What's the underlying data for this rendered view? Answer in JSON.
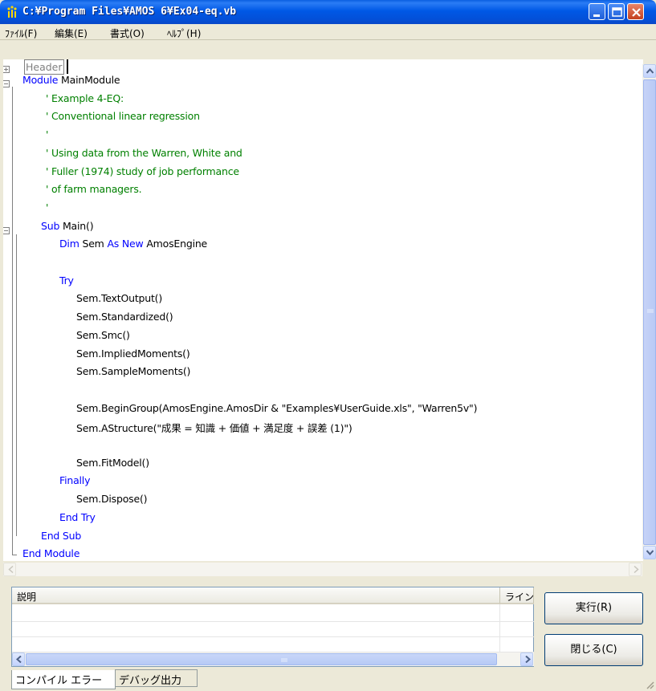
{
  "window": {
    "title": "C:¥Program Files¥AMOS 6¥Ex04-eq.vb"
  },
  "menu": {
    "items": [
      {
        "label": "ﾌｧｲﾙ(F)"
      },
      {
        "label": "編集(E)"
      },
      {
        "label": "書式(O)"
      },
      {
        "label": "ﾍﾙﾌﾟ(H)"
      }
    ]
  },
  "editor": {
    "header_label": "Header",
    "lines": [
      {
        "kind": "module",
        "kw": "Module",
        "rest": " MainModule"
      },
      {
        "kind": "comment",
        "text": "' Example 4-EQ:"
      },
      {
        "kind": "comment",
        "text": "' Conventional linear regression"
      },
      {
        "kind": "comment",
        "text": "'"
      },
      {
        "kind": "comment",
        "text": "' Using data from the Warren, White and"
      },
      {
        "kind": "comment",
        "text": "' Fuller (1974) study of job performance"
      },
      {
        "kind": "comment",
        "text": "' of farm managers."
      },
      {
        "kind": "comment",
        "text": "'"
      },
      {
        "kind": "sub",
        "kw": "Sub",
        "rest": " Main()"
      },
      {
        "kind": "dim",
        "kw1": "Dim",
        "mid": " Sem ",
        "kw2": "As New",
        "rest": " AmosEngine"
      },
      {
        "kind": "blank",
        "text": ""
      },
      {
        "kind": "kwline",
        "kw": "Try"
      },
      {
        "kind": "code",
        "text": "Sem.TextOutput()"
      },
      {
        "kind": "code",
        "text": "Sem.Standardized()"
      },
      {
        "kind": "code",
        "text": "Sem.Smc()"
      },
      {
        "kind": "code",
        "text": "Sem.ImpliedMoments()"
      },
      {
        "kind": "code",
        "text": "Sem.SampleMoments()"
      },
      {
        "kind": "blank",
        "text": ""
      },
      {
        "kind": "code",
        "text": "Sem.BeginGroup(AmosEngine.AmosDir & \"Examples¥UserGuide.xls\", \"Warren5v\")"
      },
      {
        "kind": "code",
        "text": "Sem.AStructure(\"成果 = 知識 + 価値 + 満足度 + 誤差 (1)\")"
      },
      {
        "kind": "blank",
        "text": ""
      },
      {
        "kind": "code",
        "text": "Sem.FitModel()"
      },
      {
        "kind": "kwline",
        "kw": "Finally"
      },
      {
        "kind": "code",
        "text": "Sem.Dispose()"
      },
      {
        "kind": "kwline",
        "kw": "End Try"
      },
      {
        "kind": "kwline",
        "kw": "End Sub"
      },
      {
        "kind": "kwline",
        "kw": "End Module"
      }
    ]
  },
  "errors": {
    "columns": [
      {
        "label": "説明"
      },
      {
        "label": "ライン"
      }
    ]
  },
  "buttons": {
    "run": "実行(R)",
    "close": "閉じる(C)"
  },
  "tabs": [
    {
      "label": "コンパイル エラー"
    },
    {
      "label": "デバッグ出力"
    }
  ],
  "colors": {
    "keyword": "#0000ff",
    "comment": "#008000",
    "titlebar": "#0058e6"
  }
}
